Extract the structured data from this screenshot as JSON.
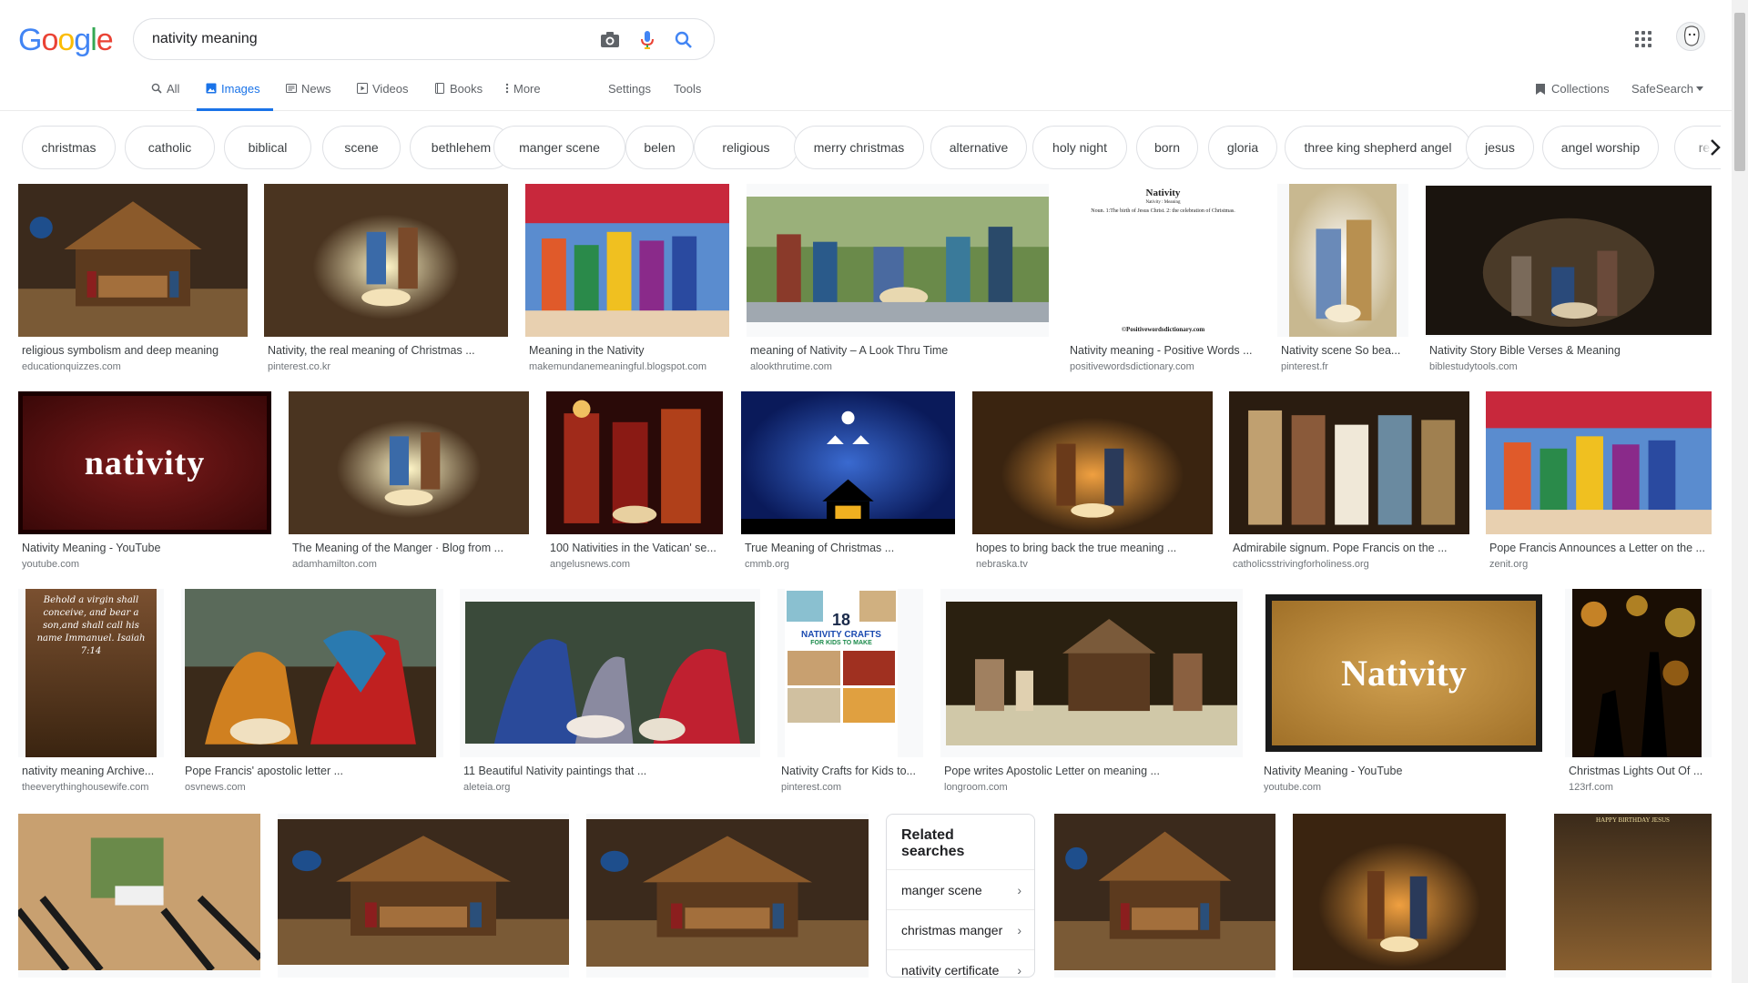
{
  "search": {
    "query": "nativity meaning"
  },
  "tabs": [
    {
      "label": "All",
      "icon": "search-icon"
    },
    {
      "label": "Images",
      "icon": "image-icon"
    },
    {
      "label": "News",
      "icon": "news-icon"
    },
    {
      "label": "Videos",
      "icon": "video-icon"
    },
    {
      "label": "Books",
      "icon": "book-icon"
    },
    {
      "label": "More",
      "icon": "more-vert-icon"
    }
  ],
  "tools": {
    "settings": "Settings",
    "tools": "Tools"
  },
  "right": {
    "collections": "Collections",
    "safesearch": "SafeSearch"
  },
  "chips": [
    "christmas",
    "catholic",
    "biblical",
    "scene",
    "bethlehem",
    "manger scene",
    "belen",
    "religious",
    "merry christmas",
    "alternative",
    "holy night",
    "born",
    "gloria",
    "three king shepherd angel",
    "jesus",
    "angel worship",
    "reali"
  ],
  "results": [
    {
      "title": "religious symbolism and deep meaning",
      "site": "educationquizzes.com"
    },
    {
      "title": "Nativity, the real meaning of Christmas ...",
      "site": "pinterest.co.kr"
    },
    {
      "title": "Meaning in the Nativity",
      "site": "makemundanemeaningful.blogspot.com"
    },
    {
      "title": "meaning of Nativity – A Look Thru Time",
      "site": "alookthrutime.com"
    },
    {
      "title": "Nativity meaning - Positive Words ...",
      "site": "positivewordsdictionary.com"
    },
    {
      "title": "Nativity scene So bea...",
      "site": "pinterest.fr"
    },
    {
      "title": "Nativity Story Bible Verses & Meaning",
      "site": "biblestudytools.com"
    },
    {
      "title": "Nativity Meaning - YouTube",
      "site": "youtube.com"
    },
    {
      "title": "The Meaning of the Manger · Blog from ...",
      "site": "adamhamilton.com"
    },
    {
      "title": "100 Nativities in the Vatican' se...",
      "site": "angelusnews.com"
    },
    {
      "title": "True Meaning of Christmas ...",
      "site": "cmmb.org"
    },
    {
      "title": "hopes to bring back the true meaning ...",
      "site": "nebraska.tv"
    },
    {
      "title": "Admirabile signum. Pope Francis on the ...",
      "site": "catholicsstrivingforholiness.org"
    },
    {
      "title": "Pope Francis Announces a Letter on the ...",
      "site": "zenit.org"
    },
    {
      "title": "nativity meaning Archive...",
      "site": "theeverythinghousewife.com"
    },
    {
      "title": "Pope Francis' apostolic letter ...",
      "site": "osvnews.com"
    },
    {
      "title": "11 Beautiful Nativity paintings that ...",
      "site": "aleteia.org"
    },
    {
      "title": "Nativity Crafts for Kids to...",
      "site": "pinterest.com"
    },
    {
      "title": "Pope writes Apostolic Letter on meaning ...",
      "site": "longroom.com"
    },
    {
      "title": "Nativity Meaning - YouTube",
      "site": "youtube.com"
    },
    {
      "title": "Christmas Lights Out Of ...",
      "site": "123rf.com"
    },
    {
      "title": "",
      "site": ""
    },
    {
      "title": "",
      "site": ""
    },
    {
      "title": "",
      "site": ""
    },
    {
      "title": "",
      "site": ""
    },
    {
      "title": "",
      "site": ""
    },
    {
      "title": "",
      "site": ""
    }
  ],
  "overlays": {
    "nativity_card_1": "nativity",
    "nativity_card_2": "Nativity",
    "dict_head": "Nativity",
    "dict_sub": "Nativity : Meaning",
    "dict_body": "Noun. 1:The birth of Jesus Christ. 2: the celebration of Christmas.",
    "dict_footer": "©Positivewordsdictionary.com",
    "verse": "Behold a virgin shall conceive, and bear a son,and shall call his name Immanuel. Isaiah 7:14",
    "crafts_num": "18",
    "crafts_title": "NATIVITY CRAFTS",
    "crafts_sub": "FOR KIDS TO MAKE",
    "bday": "HAPPY BIRTHDAY JESUS"
  },
  "related": {
    "title": "Related searches",
    "items": [
      "manger scene",
      "christmas manger",
      "nativity certificate"
    ]
  },
  "colors": {
    "accent": "#1a73e8",
    "logo_blue": "#4285f4",
    "logo_red": "#ea4335",
    "logo_yellow": "#fbbc05",
    "logo_green": "#34a853"
  }
}
